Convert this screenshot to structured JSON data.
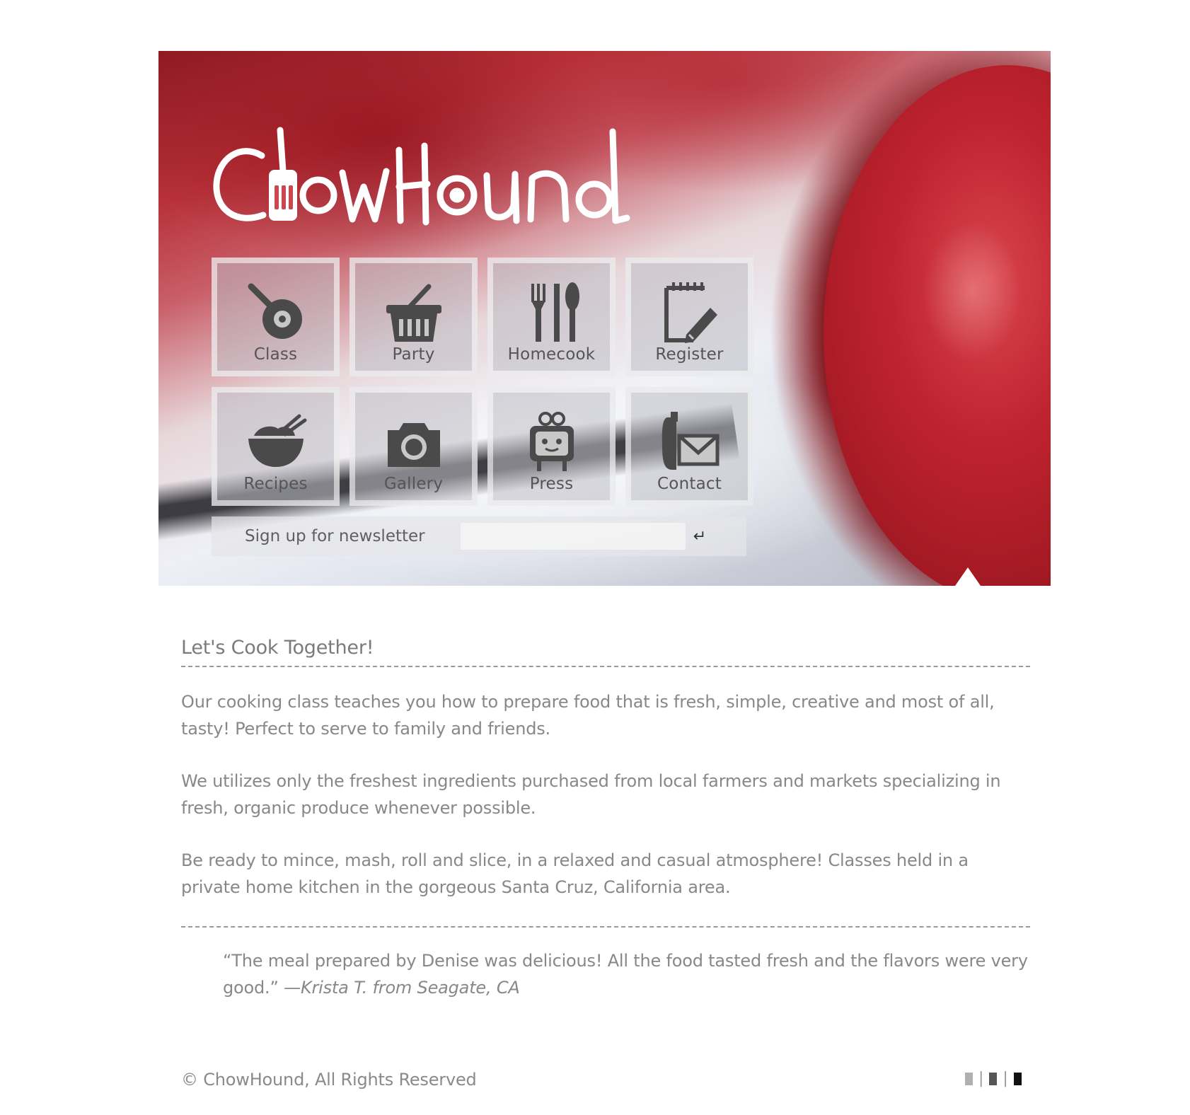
{
  "site": {
    "name": "ChowHound"
  },
  "nav": {
    "tiles": [
      {
        "label": "Class",
        "icon": "pan-egg-icon"
      },
      {
        "label": "Party",
        "icon": "basket-icon"
      },
      {
        "label": "Homecook",
        "icon": "utensils-icon"
      },
      {
        "label": "Register",
        "icon": "notepad-pencil-icon"
      },
      {
        "label": "Recipes",
        "icon": "bowl-chopsticks-icon"
      },
      {
        "label": "Gallery",
        "icon": "camera-icon"
      },
      {
        "label": "Press",
        "icon": "tv-robot-icon"
      },
      {
        "label": "Contact",
        "icon": "phone-mail-icon"
      }
    ]
  },
  "newsletter": {
    "label": "Sign up for newsletter",
    "value": "",
    "submit_icon": "enter-arrow-icon",
    "submit_glyph": "↵"
  },
  "content": {
    "heading": "Let's Cook Together!",
    "paragraphs": [
      "Our cooking class teaches you how to prepare food that is fresh, simple, creative and most of all, tasty! Perfect to serve to family and friends.",
      "We utilizes only the freshest ingredients purchased from local farmers and markets specializing in fresh, organic produce whenever possible.",
      "Be ready to mince, mash, roll and slice, in a relaxed and casual atmosphere! Classes held in a private home kitchen in the gorgeous Santa Cruz, California area."
    ],
    "testimonial": {
      "text": "“The meal prepared by Denise was delicious! All the food tasted fresh and the flavors were very good.”",
      "author": "—Krista T. from Seagate, CA"
    }
  },
  "footer": {
    "copyright": "© ChowHound, All Rights Reserved",
    "separators": [
      "|",
      "|"
    ],
    "theme_swatches": [
      "#b0b0b0",
      "#555555",
      "#111111"
    ]
  },
  "colors": {
    "tile_icon": "#4a4a4a",
    "text": "#888888",
    "apple_red": "#c02330"
  }
}
